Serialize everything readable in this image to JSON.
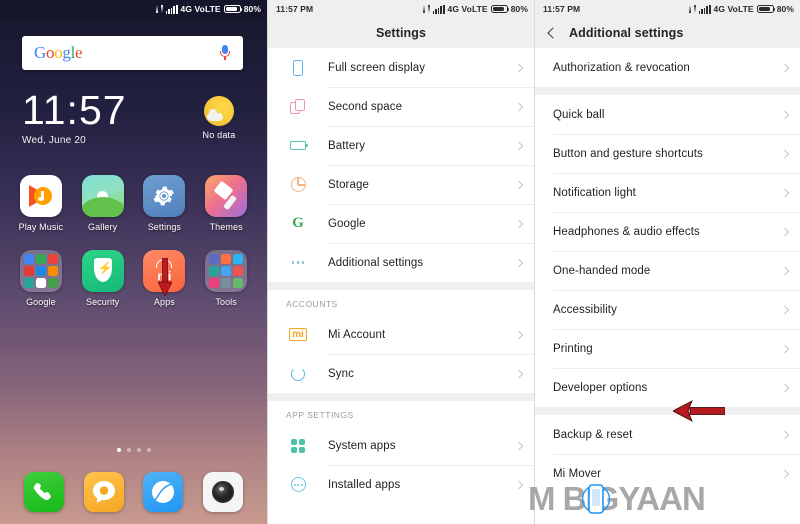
{
  "statusbar": {
    "home_time": "",
    "settings_time": "11:57 PM",
    "additional_time": "11:57 PM",
    "network": "4G VoLTE",
    "battery": "80%",
    "icons": [
      "data-transfer-icon",
      "signal-bars-icon",
      "battery-icon"
    ]
  },
  "home": {
    "search": {
      "logo": "Google",
      "mic": "microphone-icon"
    },
    "clock": {
      "time": "11:57",
      "date": "Wed, June 20"
    },
    "weather": {
      "icon": "sun-behind-cloud-icon",
      "label": "No data"
    },
    "apps_row1": [
      {
        "label": "Play Music",
        "icon": "play-music-icon"
      },
      {
        "label": "Gallery",
        "icon": "gallery-icon"
      },
      {
        "label": "Settings",
        "icon": "settings-gear-icon"
      },
      {
        "label": "Themes",
        "icon": "themes-brush-icon"
      }
    ],
    "apps_row2": [
      {
        "label": "Google",
        "icon": "google-folder-icon"
      },
      {
        "label": "Security",
        "icon": "security-shield-icon"
      },
      {
        "label": "Apps",
        "icon": "mi-apps-icon"
      },
      {
        "label": "Tools",
        "icon": "tools-folder-icon"
      }
    ],
    "page_dots": {
      "count": 4,
      "active": 1
    },
    "dock": [
      {
        "label": "Phone",
        "icon": "phone-icon"
      },
      {
        "label": "Messages",
        "icon": "message-icon"
      },
      {
        "label": "Browser",
        "icon": "browser-icon"
      },
      {
        "label": "Camera",
        "icon": "camera-icon"
      }
    ]
  },
  "settings": {
    "title": "Settings",
    "rows": [
      {
        "label": "Full screen display",
        "icon": "fullscreen-icon"
      },
      {
        "label": "Second space",
        "icon": "second-space-icon"
      },
      {
        "label": "Battery",
        "icon": "battery-icon"
      },
      {
        "label": "Storage",
        "icon": "storage-pie-icon"
      },
      {
        "label": "Google",
        "icon": "google-g-icon"
      },
      {
        "label": "Additional settings",
        "icon": "ellipsis-icon"
      }
    ],
    "section_accounts": "ACCOUNTS",
    "accounts_rows": [
      {
        "label": "Mi Account",
        "icon": "mi-logo-icon"
      },
      {
        "label": "Sync",
        "icon": "sync-icon"
      }
    ],
    "section_app_settings": "APP SETTINGS",
    "app_rows": [
      {
        "label": "System apps",
        "icon": "system-apps-icon"
      },
      {
        "label": "Installed apps",
        "icon": "installed-apps-icon"
      }
    ]
  },
  "additional": {
    "title": "Additional settings",
    "back_icon": "back-chevron-icon",
    "group1": [
      {
        "label": "Authorization & revocation"
      }
    ],
    "group2": [
      {
        "label": "Quick ball"
      },
      {
        "label": "Button and gesture shortcuts"
      },
      {
        "label": "Notification light"
      },
      {
        "label": "Headphones & audio effects"
      },
      {
        "label": "One-handed mode"
      },
      {
        "label": "Accessibility"
      },
      {
        "label": "Printing"
      },
      {
        "label": "Developer options"
      }
    ],
    "group3": [
      {
        "label": "Backup & reset"
      },
      {
        "label": "Mi Mover"
      }
    ]
  },
  "annotations": {
    "arrow_settings_app": "red-down-arrow",
    "arrow_additional_settings": "red-left-arrow",
    "arrow_developer_options": "red-left-arrow",
    "arrow_color": "#c0191e"
  },
  "watermark": {
    "text": "M BIGYAAN",
    "part1": "M",
    "part2": "BIGYAAN",
    "logo": "phone-logo-icon"
  }
}
